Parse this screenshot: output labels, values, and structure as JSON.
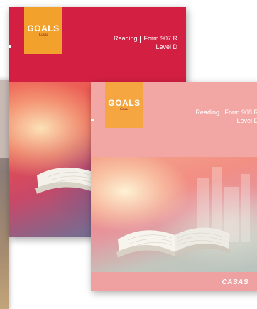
{
  "covers": [
    {
      "logo_text": "GOALS",
      "logo_sub": "Casas",
      "subject": "Reading",
      "form": "Form 907 R",
      "level": "Level D",
      "header_color": "#d31f42",
      "logo_color": "#f3a12d"
    },
    {
      "logo_text": "GOALS",
      "logo_sub": "Casas",
      "subject": "Reading",
      "form": "Form 908 R",
      "level": "Level D",
      "header_color": "#f2a7a5",
      "logo_color": "#f6a641",
      "publisher": "CASAS"
    }
  ]
}
